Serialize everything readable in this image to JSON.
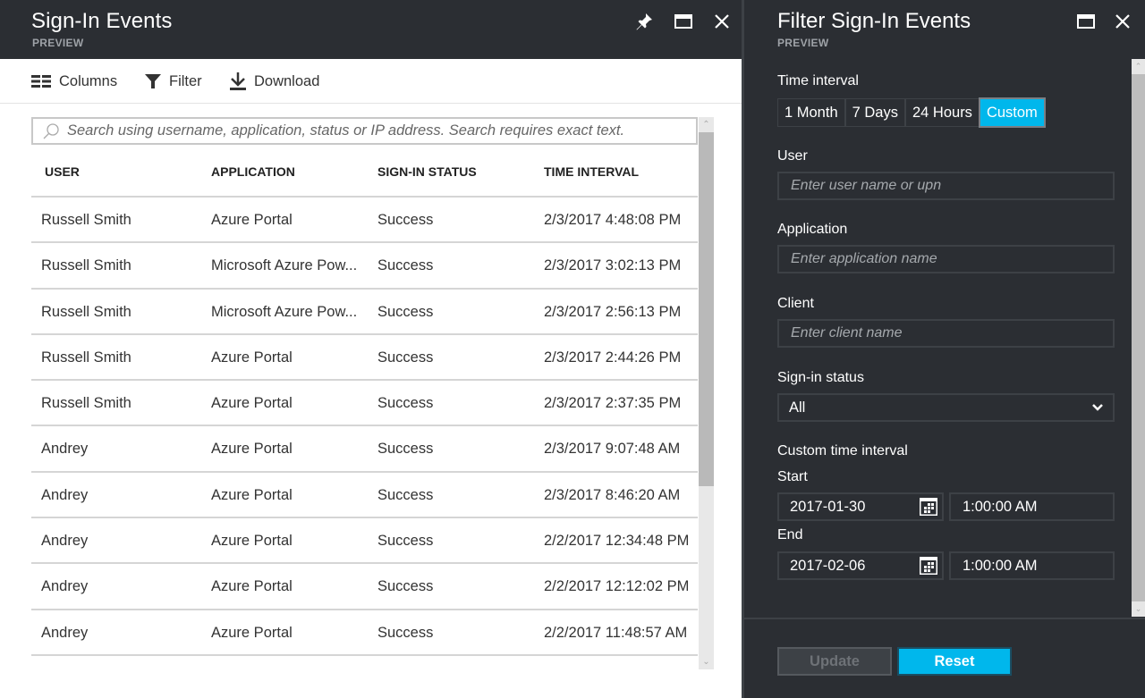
{
  "main_blade": {
    "title": "Sign-In Events",
    "subtitle": "PREVIEW",
    "header_icons": [
      "pin-icon",
      "maximize-icon",
      "close-icon"
    ],
    "toolbar": {
      "columns_label": "Columns",
      "filter_label": "Filter",
      "download_label": "Download"
    },
    "search": {
      "placeholder": "Search using username, application, status or IP address. Search requires exact text.",
      "value": ""
    },
    "table": {
      "columns": [
        "USER",
        "APPLICATION",
        "SIGN-IN STATUS",
        "TIME INTERVAL"
      ],
      "rows": [
        {
          "user": "Russell Smith",
          "application": "Azure Portal",
          "status": "Success",
          "time": "2/3/2017 4:48:08 PM"
        },
        {
          "user": "Russell Smith",
          "application": "Microsoft Azure Pow...",
          "status": "Success",
          "time": "2/3/2017 3:02:13 PM"
        },
        {
          "user": "Russell Smith",
          "application": "Microsoft Azure Pow...",
          "status": "Success",
          "time": "2/3/2017 2:56:13 PM"
        },
        {
          "user": "Russell Smith",
          "application": "Azure Portal",
          "status": "Success",
          "time": "2/3/2017 2:44:26 PM"
        },
        {
          "user": "Russell Smith",
          "application": "Azure Portal",
          "status": "Success",
          "time": "2/3/2017 2:37:35 PM"
        },
        {
          "user": "Andrey",
          "application": "Azure Portal",
          "status": "Success",
          "time": "2/3/2017 9:07:48 AM"
        },
        {
          "user": "Andrey",
          "application": "Azure Portal",
          "status": "Success",
          "time": "2/3/2017 8:46:20 AM"
        },
        {
          "user": "Andrey",
          "application": "Azure Portal",
          "status": "Success",
          "time": "2/2/2017 12:34:48 PM"
        },
        {
          "user": "Andrey",
          "application": "Azure Portal",
          "status": "Success",
          "time": "2/2/2017 12:12:02 PM"
        },
        {
          "user": "Andrey",
          "application": "Azure Portal",
          "status": "Success",
          "time": "2/2/2017 11:48:57 AM"
        }
      ]
    }
  },
  "filter_blade": {
    "title": "Filter Sign-In Events",
    "subtitle": "PREVIEW",
    "header_icons": [
      "maximize-icon",
      "close-icon"
    ],
    "time_interval": {
      "label": "Time interval",
      "options": [
        "1 Month",
        "7 Days",
        "24 Hours",
        "Custom"
      ],
      "selected": "Custom"
    },
    "user": {
      "label": "User",
      "placeholder": "Enter user name or upn",
      "value": ""
    },
    "application": {
      "label": "Application",
      "placeholder": "Enter application name",
      "value": ""
    },
    "client": {
      "label": "Client",
      "placeholder": "Enter client name",
      "value": ""
    },
    "signin_status": {
      "label": "Sign-in status",
      "selected": "All"
    },
    "custom_interval": {
      "label": "Custom time interval",
      "start_label": "Start",
      "start_date": "2017-01-30",
      "start_time": "1:00:00 AM",
      "end_label": "End",
      "end_date": "2017-02-06",
      "end_time": "1:00:00 AM"
    },
    "buttons": {
      "update": "Update",
      "reset": "Reset"
    }
  },
  "colors": {
    "header_bg": "#2b2e33",
    "accent": "#00b7ec",
    "panel_border": "#3d4146"
  }
}
